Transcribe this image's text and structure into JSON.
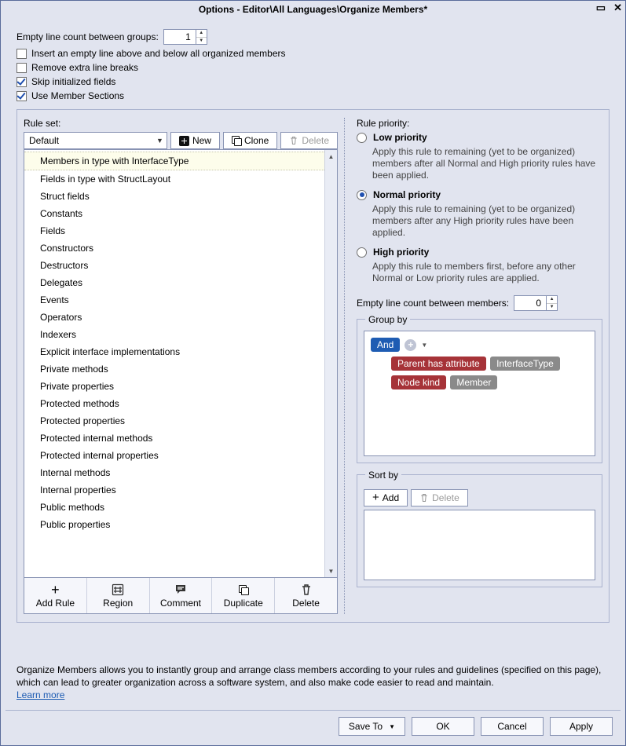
{
  "window": {
    "title": "Options - Editor\\All Languages\\Organize Members*"
  },
  "top": {
    "empty_line_label": "Empty line count between groups:",
    "empty_line_value": "1",
    "cb_insert": "Insert an empty line above and below all organized members",
    "cb_remove": "Remove extra line breaks",
    "cb_skip": "Skip initialized fields",
    "cb_sections": "Use Member Sections"
  },
  "ruleset": {
    "label": "Rule set:",
    "selected": "Default",
    "btn_new": "New",
    "btn_clone": "Clone",
    "btn_delete": "Delete",
    "rules": [
      "Members in type with InterfaceType",
      "Fields in type with StructLayout",
      "Struct fields",
      "Constants",
      "Fields",
      "Constructors",
      "Destructors",
      "Delegates",
      "Events",
      "Operators",
      "Indexers",
      "Explicit interface implementations",
      "Private methods",
      "Private properties",
      "Protected methods",
      "Protected properties",
      "Protected internal methods",
      "Protected internal properties",
      "Internal methods",
      "Internal properties",
      "Public methods",
      "Public properties"
    ]
  },
  "list_toolbar": {
    "add_rule": "Add Rule",
    "region": "Region",
    "comment": "Comment",
    "duplicate": "Duplicate",
    "delete": "Delete"
  },
  "priority": {
    "label": "Rule priority:",
    "low": {
      "title": "Low priority",
      "desc": "Apply this rule to remaining (yet to be organized) members after all Normal and High priority rules have been applied."
    },
    "normal": {
      "title": "Normal priority",
      "desc": "Apply this rule to remaining (yet to be organized) members after any High priority rules have been applied."
    },
    "high": {
      "title": "High priority",
      "desc": "Apply this rule to members first, before any other Normal or Low priority rules are applied."
    },
    "selected": "normal",
    "empty_members_label": "Empty line count between members:",
    "empty_members_value": "0"
  },
  "groupby": {
    "legend": "Group by",
    "root": "And",
    "c1_label": "Parent has attribute",
    "c1_value": "InterfaceType",
    "c2_label": "Node kind",
    "c2_value": "Member"
  },
  "sortby": {
    "legend": "Sort by",
    "add": "Add",
    "delete": "Delete"
  },
  "footer": {
    "text": "Organize Members allows you to instantly group and arrange class members according to your rules and guidelines (specified on this page), which can lead to greater organization across a software system, and also make code easier to read and maintain.",
    "learn": "Learn more"
  },
  "buttons": {
    "save_to": "Save To",
    "ok": "OK",
    "cancel": "Cancel",
    "apply": "Apply"
  }
}
